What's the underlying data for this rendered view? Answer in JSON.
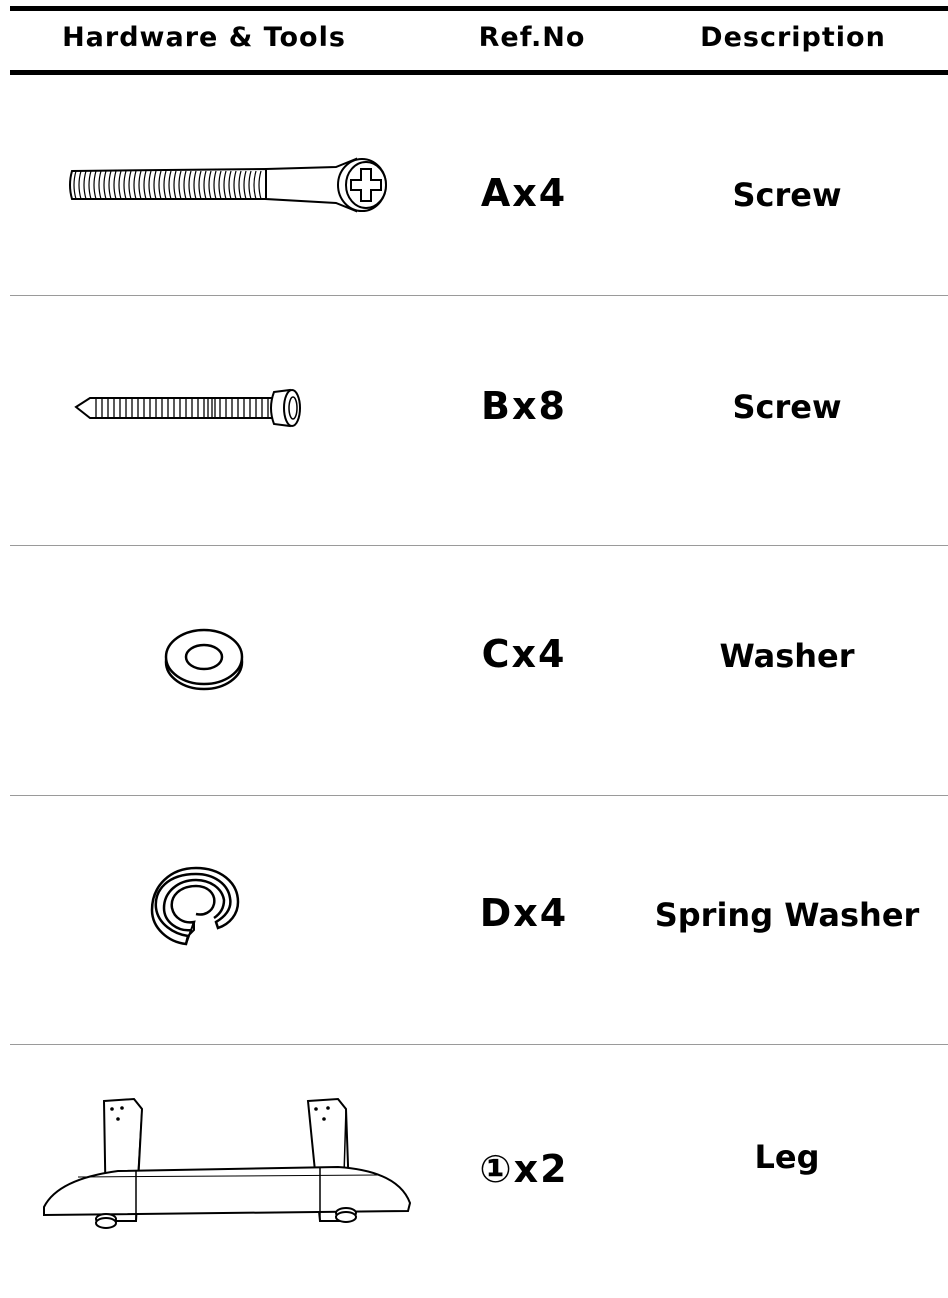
{
  "header": {
    "col_hardware": "Hardware & Tools",
    "col_ref": "Ref.No",
    "col_desc": "Description"
  },
  "items": [
    {
      "ref": "Ax4",
      "description": "Screw",
      "icon": "long-countersunk-screw-icon"
    },
    {
      "ref": "Bx8",
      "description": "Screw",
      "icon": "pan-head-wood-screw-icon"
    },
    {
      "ref": "Cx4",
      "description": "Washer",
      "icon": "flat-washer-icon"
    },
    {
      "ref": "Dx4",
      "description": "Spring Washer",
      "icon": "spring-washer-icon"
    },
    {
      "ref": "①x2",
      "description": "Leg",
      "icon": "leg-bracket-icon"
    }
  ]
}
